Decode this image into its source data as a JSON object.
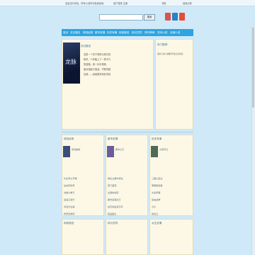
{
  "topbar": {
    "notice": "欢迎访问本站，所有小说均可免费阅读",
    "login_hint": "用户登录  注册",
    "bookmark": "书架",
    "history": "阅读记录"
  },
  "search": {
    "placeholder": "",
    "button_label": "搜索"
  },
  "nav": {
    "items": [
      "首页",
      "玄幻魔法",
      "修真武侠",
      "都市言情",
      "历史军事",
      "网游竞技",
      "科幻灵异",
      "排行榜单",
      "完本小说",
      "全部小说"
    ]
  },
  "featured": {
    "heading": "玄幻魔法",
    "cover_text": "龙脉",
    "lines": [
      "这是一个关于修炼与成长的",
      "故事，少年踏上了一条不凡",
      "的道路。他一步步修炼，",
      "面对强敌与挑战，不断突破",
      "自我……阅读更多精彩内容"
    ]
  },
  "side_panel": {
    "heading": "热门推荐",
    "line": "最新上架小说推荐列表点击阅读"
  },
  "columns": [
    {
      "title": "修真武侠",
      "book_title": "武道巅峰",
      "items": [
        "长生界之开端",
        "仙侠奇缘录",
        "剑破九重天",
        "逍遥江湖行",
        "问道长生路",
        "修罗武神传"
      ]
    },
    {
      "title": "都市言情",
      "book_title": "都市之王",
      "items": [
        "重生之都市修仙",
        "豪门盛宠",
        "总裁的秘密",
        "都市最强兵王",
        "校花的贴身高手",
        "极品医生"
      ]
    },
    {
      "title": "历史军事",
      "book_title": "大唐风云",
      "items": [
        "三国之霸业",
        "明朝那些事",
        "大秦帝国",
        "铁血战神",
        "汉乡",
        "锦衣卫"
      ]
    }
  ],
  "bottom_sections": [
    {
      "title": "网游竞技"
    },
    {
      "title": "科幻灵异"
    },
    {
      "title": "女生言情"
    }
  ]
}
